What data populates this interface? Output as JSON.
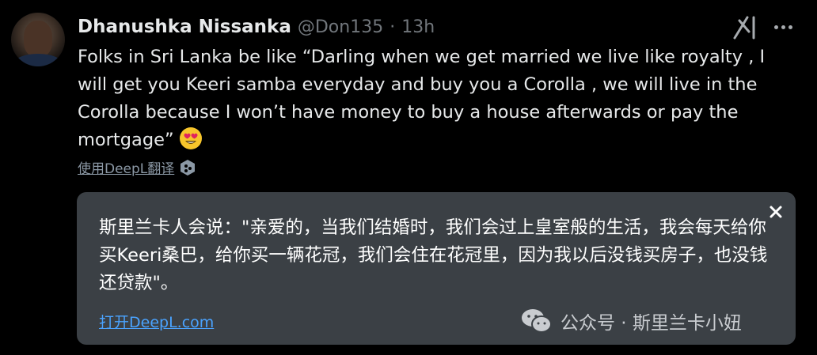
{
  "tweet": {
    "author": {
      "display_name": "Dhanushka Nissanka",
      "handle": "@Don135",
      "separator": "·",
      "time": "13h"
    },
    "text": "Folks in Sri Lanka be like “Darling when we get married we live like royalty , I will get you Keeri samba everyday and buy you a Corolla , we will live in the Corolla because I won’t have money to buy a house afterwards or pay the mortgage”",
    "emoji": "smiling-face-with-heart-eyes",
    "translate_link": "使用DeepL翻译",
    "icons": {
      "grok": "grok-icon",
      "more": "more-icon"
    }
  },
  "translation": {
    "text": "斯里兰卡人会说：\"亲爱的，当我们结婚时，我们会过上皇室般的生活，我会每天给你买Keeri桑巴，给你买一辆花冠，我们会住在花冠里，因为我以后没钱买房子，也没钱还贷款\"。",
    "open_link": "打开DeepL.com"
  },
  "watermark": {
    "text": "公众号 · 斯里兰卡小妞"
  },
  "colors": {
    "background": "#000000",
    "text_primary": "#e7e9ea",
    "text_secondary": "#71767b",
    "translation_bg": "#3b4045",
    "link_blue": "#4aa3ff"
  }
}
